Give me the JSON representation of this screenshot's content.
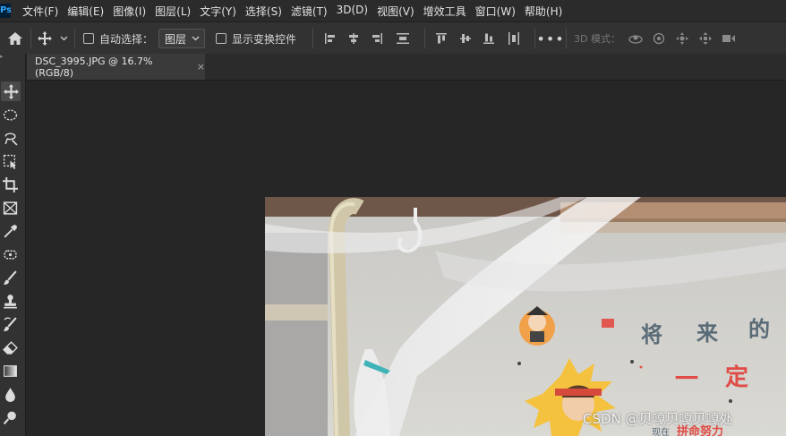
{
  "app": {
    "logo": "Ps"
  },
  "menu": [
    "文件(F)",
    "编辑(E)",
    "图像(I)",
    "图层(L)",
    "文字(Y)",
    "选择(S)",
    "滤镜(T)",
    "3D(D)",
    "视图(V)",
    "增效工具",
    "窗口(W)",
    "帮助(H)"
  ],
  "options": {
    "auto_select_label": "自动选择：",
    "auto_select_checked": false,
    "layer_select_value": "图层",
    "show_transform_label": "显示变换控件",
    "show_transform_checked": false,
    "mode_3d_label": "3D 模式："
  },
  "document": {
    "tab_title": "DSC_3995.JPG @ 16.7%(RGB/8)",
    "close_symbol": "×"
  },
  "photo": {
    "sign_chars": [
      "将",
      "来",
      "的"
    ],
    "sign_char_2": "一",
    "sign_char_3": "定",
    "sign_small": "现在",
    "sign_small_red": "拼命努力"
  },
  "watermark": "CSDN @贝嘎贝嘎贝嘎处",
  "icons": {
    "home": "home-icon",
    "move": "move-icon",
    "more": "more-icon"
  },
  "colors": {
    "menubar": "#2b2b2b",
    "optionsbar": "#323232",
    "canvas_bg": "#262626",
    "ps_blue": "#31a8ff"
  }
}
